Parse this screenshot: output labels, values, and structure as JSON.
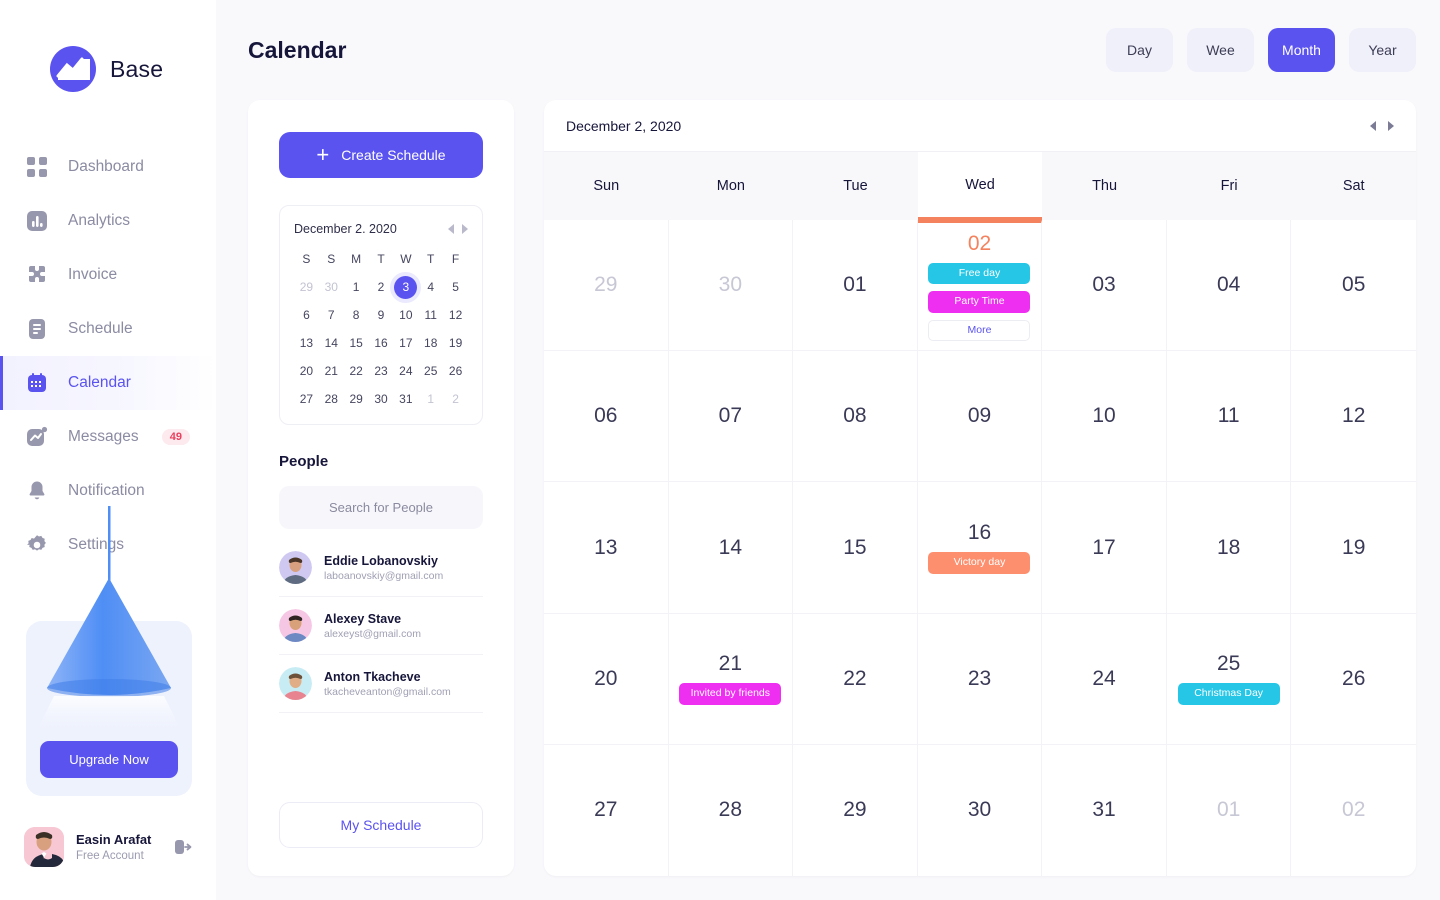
{
  "brand": {
    "name": "Base",
    "logo_icon": "chart-wave-logo"
  },
  "sidebar": {
    "items": [
      {
        "label": "Dashboard",
        "icon": "grid-icon",
        "active": false
      },
      {
        "label": "Analytics",
        "icon": "bar-chart-icon",
        "active": false
      },
      {
        "label": "Invoice",
        "icon": "invoice-icon",
        "active": false
      },
      {
        "label": "Schedule",
        "icon": "document-list-icon",
        "active": false
      },
      {
        "label": "Calendar",
        "icon": "calendar-icon",
        "active": true
      },
      {
        "label": "Messages",
        "icon": "message-wave-icon",
        "active": false,
        "badge": "49"
      },
      {
        "label": "Notification",
        "icon": "bell-icon",
        "active": false
      },
      {
        "label": "Settings",
        "icon": "gear-icon",
        "active": false
      }
    ],
    "upgrade": {
      "button_label": "Upgrade Now",
      "illustration": "lamp-illustration"
    },
    "profile": {
      "name": "Easin Arafat",
      "account_type": "Free Account",
      "logout_icon": "logout-icon",
      "avatar": "user-avatar"
    }
  },
  "header": {
    "title": "Calendar",
    "views": [
      {
        "label": "Day",
        "active": false
      },
      {
        "label": "Wee",
        "active": false
      },
      {
        "label": "Month",
        "active": true
      },
      {
        "label": "Year",
        "active": false
      }
    ]
  },
  "left_panel": {
    "create_button": "Create Schedule",
    "mini_calendar": {
      "title": "December 2. 2020",
      "prev_icon": "triangle-left-icon",
      "next_icon": "triangle-right-icon",
      "weekday_labels": [
        "S",
        "S",
        "M",
        "T",
        "W",
        "T",
        "F"
      ],
      "days": [
        {
          "n": "29",
          "muted": true
        },
        {
          "n": "30",
          "muted": true
        },
        {
          "n": "1"
        },
        {
          "n": "2"
        },
        {
          "n": "3",
          "selected": true
        },
        {
          "n": "4"
        },
        {
          "n": "5"
        },
        {
          "n": "6"
        },
        {
          "n": "7"
        },
        {
          "n": "8"
        },
        {
          "n": "9"
        },
        {
          "n": "10"
        },
        {
          "n": "11"
        },
        {
          "n": "12"
        },
        {
          "n": "13"
        },
        {
          "n": "14"
        },
        {
          "n": "15"
        },
        {
          "n": "16"
        },
        {
          "n": "17"
        },
        {
          "n": "18"
        },
        {
          "n": "19"
        },
        {
          "n": "20"
        },
        {
          "n": "21"
        },
        {
          "n": "22"
        },
        {
          "n": "23"
        },
        {
          "n": "24"
        },
        {
          "n": "25"
        },
        {
          "n": "26"
        },
        {
          "n": "27"
        },
        {
          "n": "28"
        },
        {
          "n": "29"
        },
        {
          "n": "30"
        },
        {
          "n": "31"
        },
        {
          "n": "1",
          "muted": true
        },
        {
          "n": "2",
          "muted": true
        }
      ]
    },
    "people_title": "People",
    "search_placeholder": "Search for People",
    "people": [
      {
        "name": "Eddie Lobanovskiy",
        "email": "laboanovskiy@gmail.com",
        "avatar_bg": "#cfc9f2"
      },
      {
        "name": "Alexey Stave",
        "email": "alexeyst@gmail.com",
        "avatar_bg": "#f6c7e4"
      },
      {
        "name": "Anton Tkacheve",
        "email": "tkacheveanton@gmail.com",
        "avatar_bg": "#c7ecf4"
      }
    ],
    "my_schedule_button": "My Schedule"
  },
  "calendar": {
    "current_date": "December 2, 2020",
    "prev_icon": "triangle-left-icon",
    "next_icon": "triangle-right-icon",
    "weekdays": [
      "Sun",
      "Mon",
      "Tue",
      "Wed",
      "Thu",
      "Fri",
      "Sat"
    ],
    "highlighted_weekday_index": 3,
    "weeks": [
      [
        {
          "day": "29",
          "muted": true,
          "events": []
        },
        {
          "day": "30",
          "muted": true,
          "events": []
        },
        {
          "day": "01",
          "events": []
        },
        {
          "day": "02",
          "today": true,
          "events": [
            {
              "label": "Free day",
              "color": "cyan"
            },
            {
              "label": "Party Time",
              "color": "magenta"
            },
            {
              "label": "More",
              "color": "more"
            }
          ]
        },
        {
          "day": "03",
          "events": []
        },
        {
          "day": "04",
          "events": []
        },
        {
          "day": "05",
          "events": []
        }
      ],
      [
        {
          "day": "06",
          "events": []
        },
        {
          "day": "07",
          "events": []
        },
        {
          "day": "08",
          "events": []
        },
        {
          "day": "09",
          "events": []
        },
        {
          "day": "10",
          "events": []
        },
        {
          "day": "11",
          "events": []
        },
        {
          "day": "12",
          "events": []
        }
      ],
      [
        {
          "day": "13",
          "events": []
        },
        {
          "day": "14",
          "events": []
        },
        {
          "day": "15",
          "events": []
        },
        {
          "day": "16",
          "events": [
            {
              "label": "Victory day",
              "color": "coral"
            }
          ]
        },
        {
          "day": "17",
          "events": []
        },
        {
          "day": "18",
          "events": []
        },
        {
          "day": "19",
          "events": []
        }
      ],
      [
        {
          "day": "20",
          "events": []
        },
        {
          "day": "21",
          "events": [
            {
              "label": "Invited by friends",
              "color": "magenta"
            }
          ]
        },
        {
          "day": "22",
          "events": []
        },
        {
          "day": "23",
          "events": []
        },
        {
          "day": "24",
          "events": []
        },
        {
          "day": "25",
          "events": [
            {
              "label": "Christmas Day",
              "color": "cyan"
            }
          ]
        },
        {
          "day": "26",
          "events": []
        }
      ],
      [
        {
          "day": "27",
          "events": []
        },
        {
          "day": "28",
          "events": []
        },
        {
          "day": "29",
          "events": []
        },
        {
          "day": "30",
          "events": []
        },
        {
          "day": "31",
          "events": []
        },
        {
          "day": "01",
          "muted": true,
          "events": []
        },
        {
          "day": "02",
          "muted": true,
          "events": []
        }
      ]
    ]
  },
  "colors": {
    "accent": "#5b53f0",
    "today": "#f4825e",
    "cyan": "#26c6e6",
    "magenta": "#ee2ef0",
    "coral": "#fd8f6e",
    "badge_red": "#e8415f"
  }
}
